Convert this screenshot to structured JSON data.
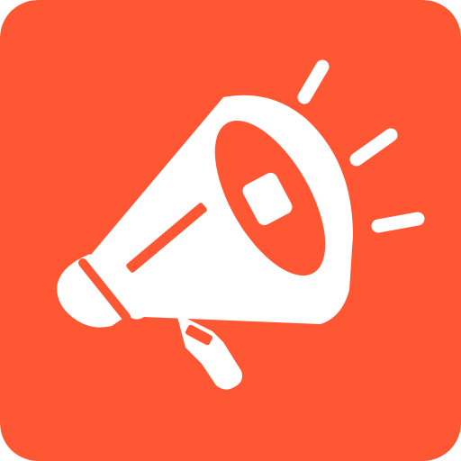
{
  "icon": {
    "name": "megaphone-icon",
    "background_color": "#FF5733",
    "foreground_color": "#FFFFFF",
    "sound_wave_count": 3
  }
}
